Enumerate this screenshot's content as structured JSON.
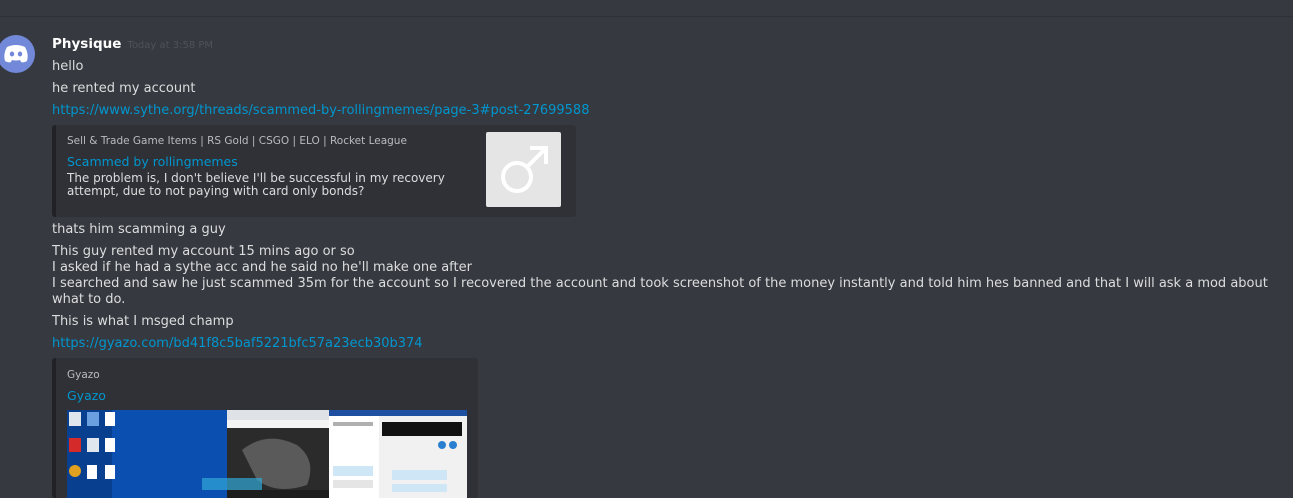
{
  "message": {
    "username": "Physique",
    "timestamp": "Today at 3:58 PM",
    "lines": [
      "hello",
      "he rented my account",
      "https://www.sythe.org/threads/scammed-by-rollingmemes/page-3#post-27699588",
      "thats him scamming a guy",
      "This guy rented my account 15 mins ago or so",
      "I asked if he had a sythe acc and he said no he'll make one after",
      "I searched and saw he just scammed 35m for the account so I recovered the account and took screenshot of the money instantly and told him hes banned and that I will ask a mod about what to do.",
      "This is what I msged champ",
      "https://gyazo.com/bd41f8c5baf5221bfc57a23ecb30b374"
    ]
  },
  "embed1": {
    "provider": "Sell & Trade Game Items | RS Gold | CSGO | ELO | Rocket League",
    "title": "Scammed by rollingmemes",
    "description": "The problem is, I don't believe I'll be successful in my recovery attempt, due to not paying with card only bonds?",
    "thumbnail_icon": "male-symbol-icon"
  },
  "embed2": {
    "provider": "Gyazo",
    "title": "Gyazo",
    "image_icon": "screenshot-image"
  },
  "colors": {
    "background": "#36393f",
    "link": "#0096cf",
    "avatar": "#7289da",
    "embed_bg": "#2f3136"
  }
}
